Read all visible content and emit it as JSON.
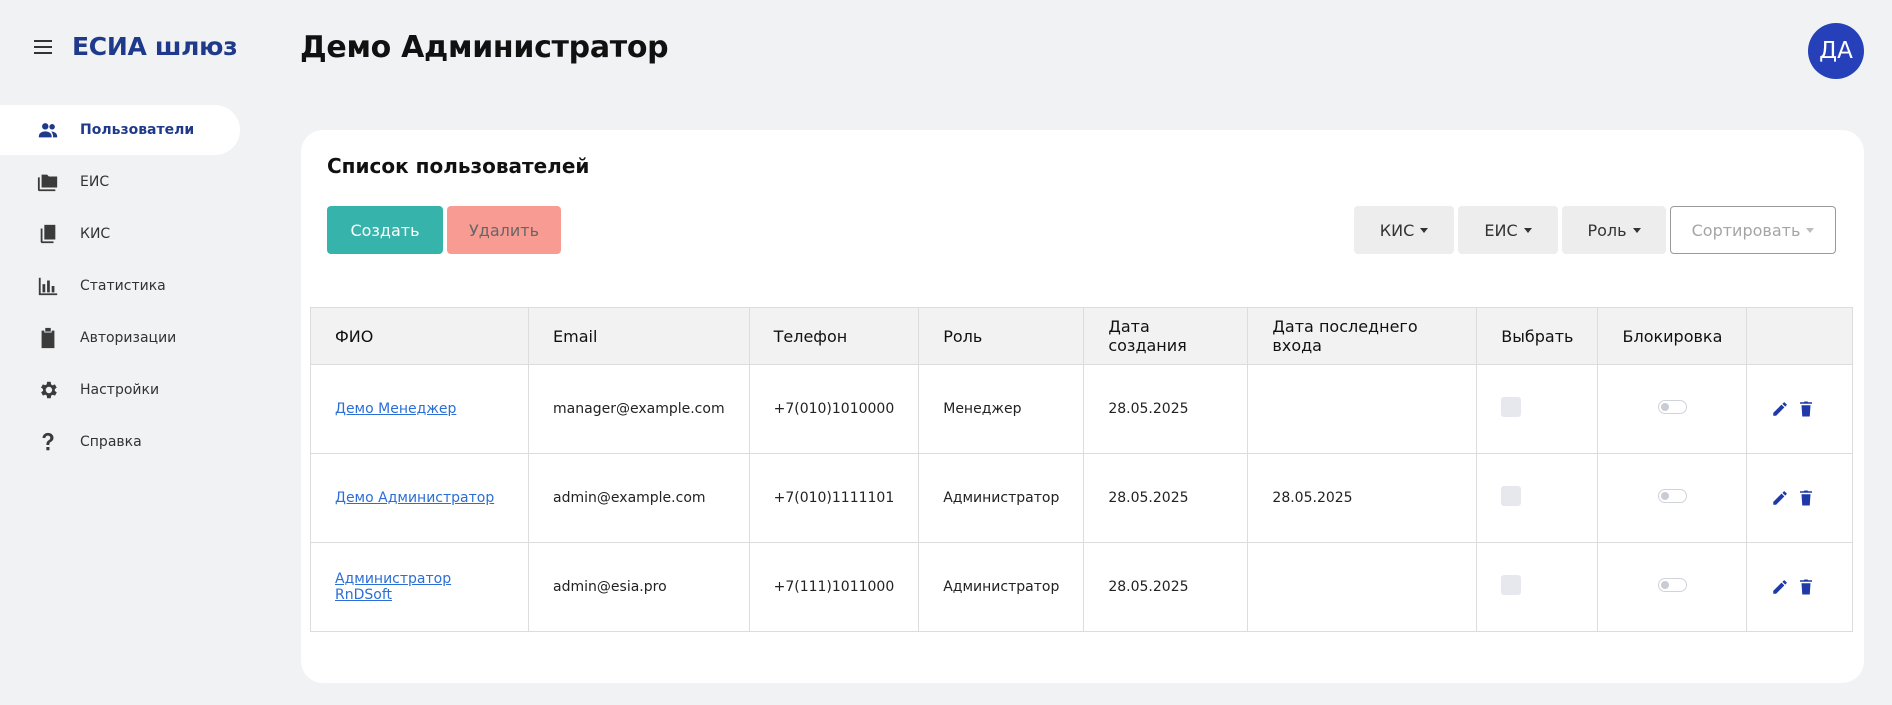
{
  "app": {
    "brand": "ЕСИА шлюз"
  },
  "nav": {
    "items": [
      {
        "label": "Пользователи",
        "icon": "users-icon",
        "active": true
      },
      {
        "label": "ЕИС",
        "icon": "folders-icon"
      },
      {
        "label": "КИС",
        "icon": "copy-icon"
      },
      {
        "label": "Статистика",
        "icon": "bar-chart-icon"
      },
      {
        "label": "Авторизации",
        "icon": "badge-icon"
      },
      {
        "label": "Настройки",
        "icon": "gear-icon"
      },
      {
        "label": "Справка",
        "icon": "question-icon"
      }
    ]
  },
  "header": {
    "title": "Демо Администратор",
    "avatar_initials": "ДА"
  },
  "card": {
    "title": "Список пользователей",
    "create_label": "Создать",
    "delete_label": "Удалить",
    "filters": {
      "kis": "КИС",
      "eis": "ЕИС",
      "role": "Роль",
      "sort": "Сортировать"
    }
  },
  "table": {
    "columns": [
      "ФИО",
      "Email",
      "Телефон",
      "Роль",
      "Дата создания",
      "Дата последнего входа",
      "Выбрать",
      "Блокировка",
      ""
    ],
    "rows": [
      {
        "name": "Демо Менеджер",
        "email": "manager@example.com",
        "phone": "+7(010)1010000",
        "role": "Менеджер",
        "created": "28.05.2025",
        "last_login": ""
      },
      {
        "name": "Демо Администратор",
        "email": "admin@example.com",
        "phone": "+7(010)1111101",
        "role": "Администратор",
        "created": "28.05.2025",
        "last_login": "28.05.2025"
      },
      {
        "name": "Администратор RnDSoft",
        "email": "admin@esia.pro",
        "phone": "+7(111)1011000",
        "role": "Администратор",
        "created": "28.05.2025",
        "last_login": ""
      }
    ]
  },
  "colors": {
    "brand": "#1f3a8a",
    "create": "#36b3aa",
    "delete": "#f79b93",
    "avatar": "#2540b8",
    "link": "#2b6fd6"
  }
}
